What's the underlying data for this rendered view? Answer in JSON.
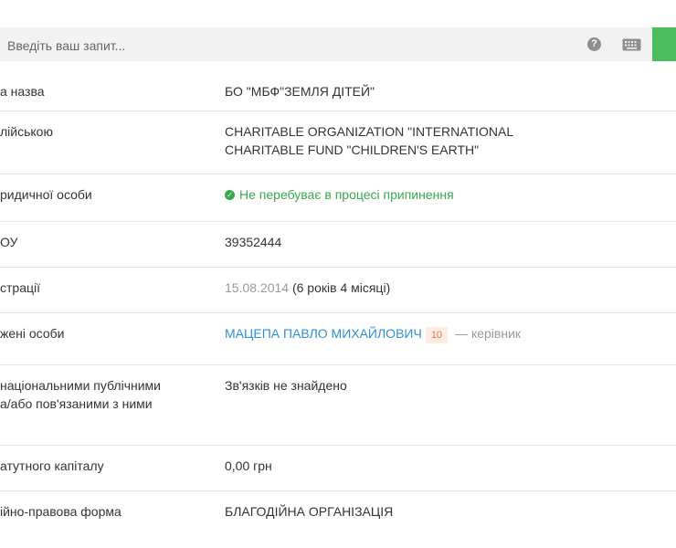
{
  "search": {
    "placeholder": "Введіть ваш запит...",
    "help_glyph": "?"
  },
  "rows": [
    {
      "label": "а назва",
      "value": "БО \"МБФ\"ЗЕМЛЯ ДІТЕЙ\""
    },
    {
      "label": "лійською",
      "value": "CHARITABLE ORGANIZATION \"INTERNATIONAL CHARITABLE FUND \"CHILDREN'S EARTH\""
    },
    {
      "label": "ридичної особи",
      "value": "Не перебуває в процесі припинення",
      "status_color": "#3aa84c"
    },
    {
      "label": "ОУ",
      "value": "39352444"
    },
    {
      "label": "страції",
      "date": "15.08.2014",
      "duration": "(6 років 4 місяці)"
    },
    {
      "label": "жені особи",
      "person": "МАЦЕПА ПАВЛО МИХАЙЛОВИЧ",
      "badge": "10",
      "role": "— керівник"
    },
    {
      "label_line1": "національними публічними",
      "label_line2": "а/або пов'язаними з ними",
      "value": "Зв'язків не знайдено"
    },
    {
      "label": "атутного капіталу",
      "value": "0,00 грн"
    },
    {
      "label": "ійно-правова форма",
      "value": "БЛАГОДІЙНА ОРГАНІЗАЦІЯ"
    }
  ],
  "colors": {
    "accent": "#4cbb5d",
    "link": "#2f8fd5",
    "status": "#3aa84c",
    "badge_text": "#e0794a"
  }
}
